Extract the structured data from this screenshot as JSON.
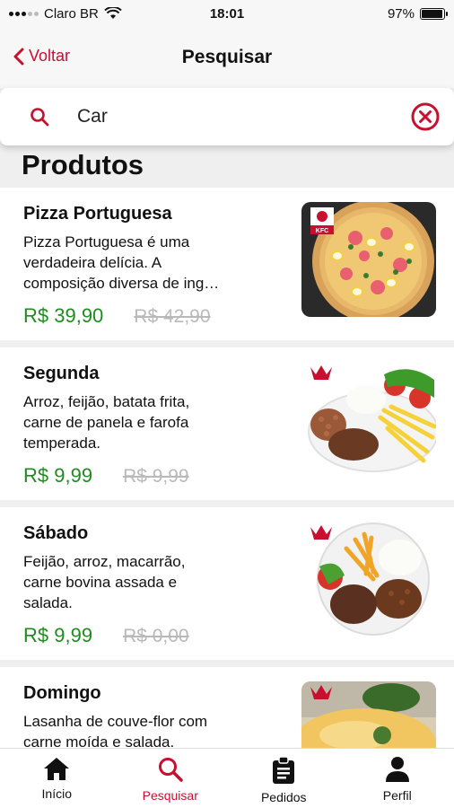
{
  "status_bar": {
    "carrier": "Claro BR",
    "time": "18:01",
    "battery": "97%",
    "battery_level": 0.97
  },
  "nav": {
    "back_label": "Voltar",
    "title": "Pesquisar"
  },
  "search": {
    "value": "Car"
  },
  "section_title": "Produtos",
  "products": [
    {
      "name": "Pizza Portuguesa",
      "description": "Pizza Portuguesa é uma\nverdadeira delícia. A\ncomposição diversa de ing…",
      "price": "R$ 39,90",
      "old_price": "R$ 42,90",
      "image_label": "KFC"
    },
    {
      "name": "Segunda",
      "description": "Arroz, feijão, batata frita,\ncarne de panela e farofa\ntemperada.",
      "price": "R$ 9,99",
      "old_price": "R$ 9,99"
    },
    {
      "name": "Sábado",
      "description": "Feijão, arroz, macarrão,\ncarne bovina assada e\nsalada.",
      "price": "R$ 9,99",
      "old_price": "R$ 0,00"
    },
    {
      "name": "Domingo",
      "description": " Lasanha de couve-flor com\ncarne moída e salada.",
      "price": "",
      "old_price": ""
    }
  ],
  "tabs": [
    {
      "label": "Início",
      "icon": "home-icon"
    },
    {
      "label": "Pesquisar",
      "icon": "search-icon"
    },
    {
      "label": "Pedidos",
      "icon": "clipboard-icon"
    },
    {
      "label": "Perfil",
      "icon": "person-icon"
    }
  ],
  "colors": {
    "accent": "#c8102e",
    "price_green": "#1f8c1f",
    "old_price_gray": "#b9b9b9"
  }
}
